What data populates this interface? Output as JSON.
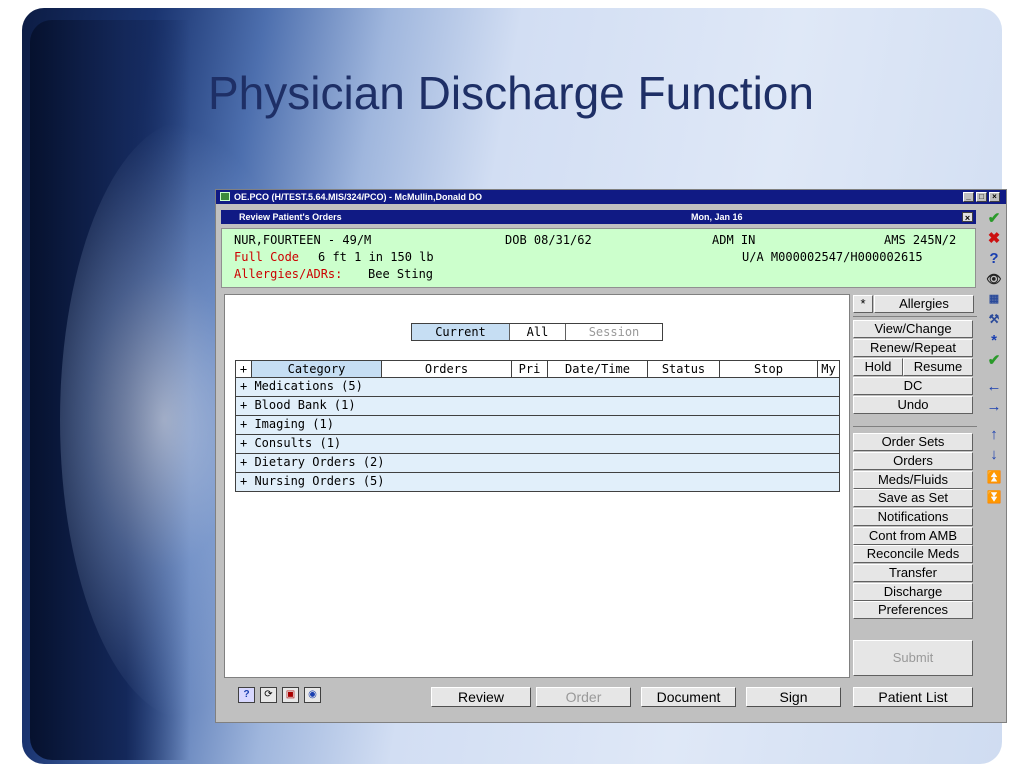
{
  "slide": {
    "title": "Physician Discharge Function"
  },
  "window": {
    "title": "OE.PCO (H/TEST.5.64.MIS/324/PCO) - McMullin,Donald DO",
    "controls": {
      "minimize": "_",
      "maximize": "□",
      "close": "×"
    }
  },
  "subheader": {
    "title": "Review Patient's Orders",
    "date": "Mon, Jan 16",
    "close": "×"
  },
  "patient": {
    "name_age": "NUR,FOURTEEN - 49/M",
    "dob": "DOB 08/31/62",
    "adm": "ADM IN",
    "location": "AMS 245N/2",
    "code_label": "Full Code",
    "height_weight": "6 ft 1 in 150 lb",
    "ids": "U/A M000002547/H000002615",
    "allergy_label": "Allergies/ADRs:",
    "allergy_value": "Bee Sting"
  },
  "view_toggle": {
    "current": "Current",
    "all": "All",
    "session": "Session"
  },
  "grid": {
    "headers": {
      "plus": "+",
      "category": "Category",
      "orders": "Orders",
      "pri": "Pri",
      "datetime": "Date/Time",
      "status": "Status",
      "stop": "Stop",
      "my": "My"
    },
    "rows": [
      "+ Medications (5)",
      "+ Blood Bank (1)",
      "+ Imaging (1)",
      "+ Consults (1)",
      "+ Dietary Orders (2)",
      "+ Nursing Orders (5)"
    ]
  },
  "side": {
    "star": "*",
    "allergies": "Allergies",
    "view_change": "View/Change",
    "renew_repeat": "Renew/Repeat",
    "hold": "Hold",
    "resume": "Resume",
    "dc": "DC",
    "undo": "Undo",
    "order_sets": "Order Sets",
    "orders": "Orders",
    "meds_fluids": "Meds/Fluids",
    "save_as_set": "Save as Set",
    "notifications": "Notifications",
    "cont_from_amb": "Cont from AMB",
    "reconcile_meds": "Reconcile Meds",
    "transfer": "Transfer",
    "discharge": "Discharge",
    "preferences": "Preferences",
    "submit": "Submit"
  },
  "bottom": {
    "help_icon": "?",
    "review": "Review",
    "order": "Order",
    "document": "Document",
    "sign": "Sign",
    "patient_list": "Patient List"
  },
  "colors": {
    "titlebar": "#101a84",
    "banner": "#ccffcc",
    "grid_row": "#e1effa",
    "accent_green": "#2a9a2a",
    "accent_red": "#cc1111",
    "accent_blue": "#1a3fb0"
  }
}
